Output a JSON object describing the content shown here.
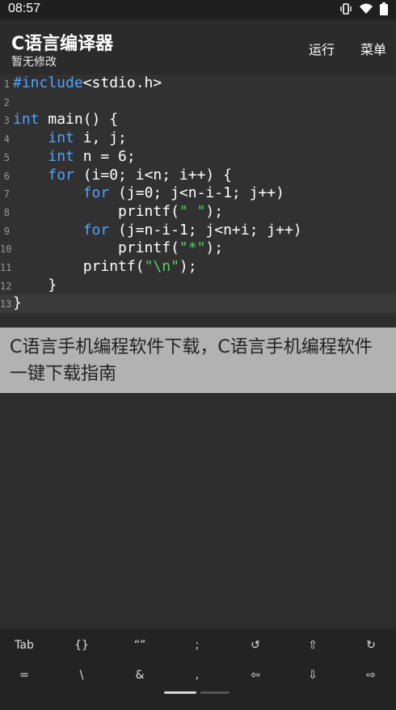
{
  "status": {
    "time": "08:57"
  },
  "appbar": {
    "title": "C语言编译器",
    "subtitle": "暂无修改",
    "run": "运行",
    "menu": "菜单"
  },
  "editor": {
    "lines": [
      {
        "num": "1"
      },
      {
        "num": "2"
      },
      {
        "num": "3"
      },
      {
        "num": "4"
      },
      {
        "num": "5"
      },
      {
        "num": "6"
      },
      {
        "num": "7"
      },
      {
        "num": "8"
      },
      {
        "num": "9"
      },
      {
        "num": "10"
      },
      {
        "num": "11"
      },
      {
        "num": "12"
      },
      {
        "num": "13"
      }
    ],
    "code": {
      "l1_pre": "#include",
      "l1_rest": "<stdio.h>",
      "l3_kw": "int",
      "l3_rest": " main() {",
      "l4_kw": "int",
      "l4_rest": " i, j;",
      "l5_kw": "int",
      "l5_rest": " n = 6;",
      "l6_kw": "for",
      "l6_rest": " (i=0; i<n; i++) {",
      "l7_kw": "for",
      "l7_rest": " (j=0; j<n-i-1; j++)",
      "l8_a": "printf(",
      "l8_str": "\" \"",
      "l8_b": ");",
      "l9_kw": "for",
      "l9_rest": " (j=n-i-1; j<n+i; j++)",
      "l10_a": "printf(",
      "l10_str": "\"*\"",
      "l10_b": ");",
      "l11_a": "printf(",
      "l11_str": "\"\\n\"",
      "l11_b": ");",
      "l12": "}",
      "l13": "}"
    }
  },
  "overlay": {
    "text": "C语言手机编程软件下载，C语言手机编程软件一键下载指南"
  },
  "keyboard": {
    "row1": [
      "Tab",
      "{}",
      "“”",
      ";",
      "↺",
      "⇧",
      "↻"
    ],
    "row2": [
      "=",
      "\\",
      "&",
      ",",
      "⇦",
      "⇩",
      "⇨"
    ]
  }
}
